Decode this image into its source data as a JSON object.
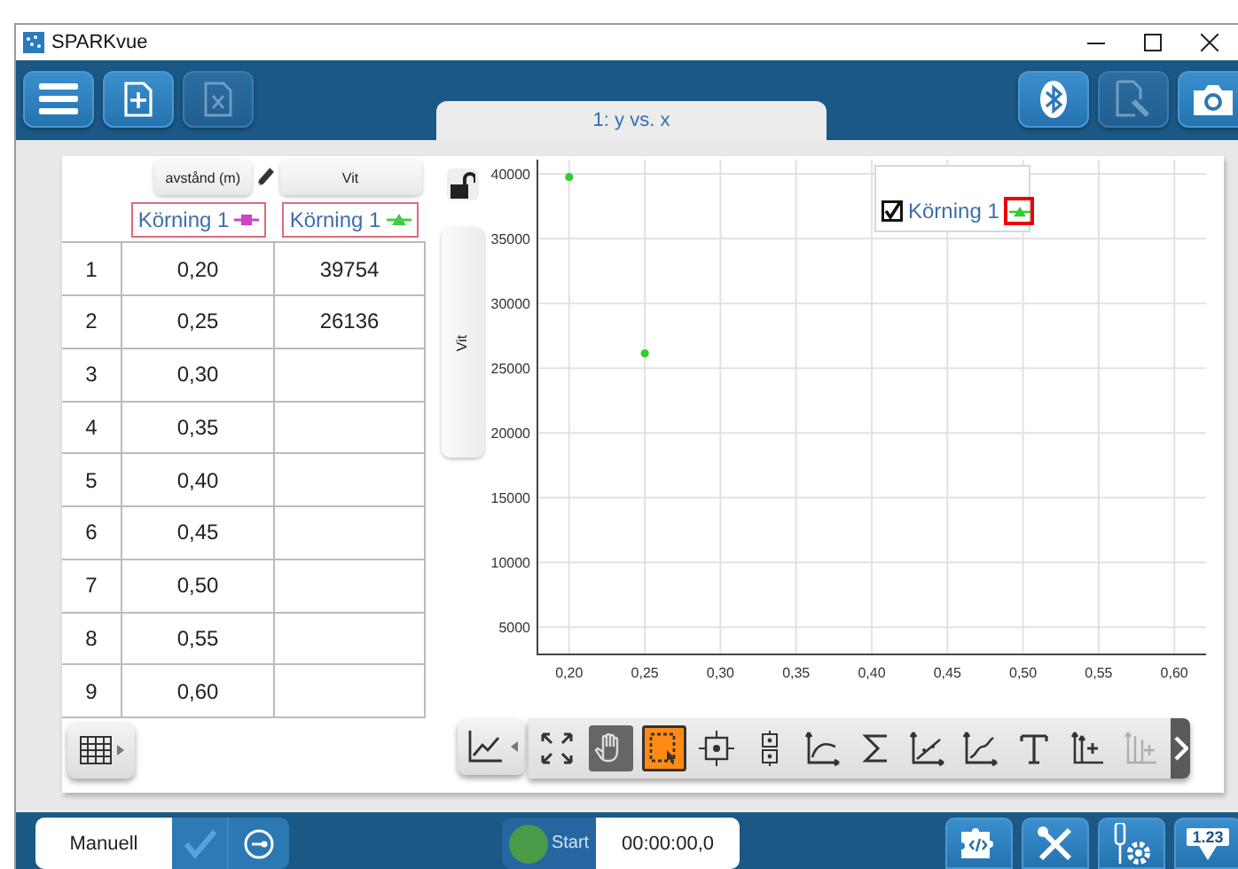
{
  "window": {
    "title": "SPARKvue"
  },
  "toolbar": {
    "left": [
      {
        "kind": "menu",
        "disabled": false
      },
      {
        "kind": "new-page",
        "disabled": false
      },
      {
        "kind": "export",
        "disabled": true
      }
    ],
    "right": [
      {
        "kind": "bluetooth",
        "disabled": false
      },
      {
        "kind": "journal",
        "disabled": true
      },
      {
        "kind": "camera",
        "disabled": false
      }
    ]
  },
  "tabs": [
    {
      "label": "1: y vs. x",
      "selected": true
    }
  ],
  "table": {
    "columns": [
      {
        "header": "avstånd (m)",
        "run": "Körning 1",
        "color": "#cc44cc"
      },
      {
        "header": "Vit",
        "run": "Körning 1",
        "color": "#44cc44"
      }
    ],
    "rows": [
      {
        "number": "1",
        "values": [
          "0,20",
          "39754"
        ]
      },
      {
        "number": "2",
        "values": [
          "0,25",
          "26136"
        ]
      },
      {
        "number": "3",
        "values": [
          "0,30"
        ]
      },
      {
        "number": "4",
        "values": [
          "0,35"
        ]
      },
      {
        "number": "5",
        "values": [
          "0,40"
        ]
      },
      {
        "number": "6",
        "values": [
          "0,45"
        ]
      },
      {
        "number": "7",
        "values": [
          "0,50"
        ]
      },
      {
        "number": "8",
        "values": [
          "0,55"
        ]
      },
      {
        "number": "9",
        "values": [
          "0,60"
        ]
      }
    ]
  },
  "graph": {
    "locked": false,
    "y_axis_label": "Vit",
    "legend": [
      {
        "checked": true
      }
    ],
    "chart_data": {
      "type": "scatter",
      "grid": true,
      "x": [
        0.2,
        0.25
      ],
      "series": [
        {
          "name": "Körning 1",
          "color": "#33cc33",
          "values": [
            39754,
            26136
          ]
        }
      ],
      "xlim": [
        0.179,
        0.621
      ],
      "ylim": [
        2900,
        41100
      ],
      "xticks": [
        {
          "value": 0.2,
          "label": "0,20"
        },
        {
          "value": 0.25,
          "label": "0,25"
        },
        {
          "value": 0.3,
          "label": "0,30"
        },
        {
          "value": 0.35,
          "label": "0,35"
        },
        {
          "value": 0.4,
          "label": "0,40"
        },
        {
          "value": 0.45,
          "label": "0,45"
        },
        {
          "value": 0.5,
          "label": "0,50"
        },
        {
          "value": 0.55,
          "label": "0,55"
        },
        {
          "value": 0.6,
          "label": "0,60"
        }
      ],
      "yticks": [
        5000,
        10000,
        15000,
        20000,
        25000,
        30000,
        35000,
        40000
      ]
    }
  },
  "graph_tools": [
    {
      "kind": "scale-fit",
      "selected": false,
      "disabled": false
    },
    {
      "kind": "pan",
      "selected": false,
      "disabled": false
    },
    {
      "kind": "select",
      "selected": true,
      "disabled": false
    },
    {
      "kind": "coordinates",
      "selected": false,
      "disabled": false
    },
    {
      "kind": "delta",
      "selected": false,
      "disabled": false
    },
    {
      "kind": "curve-fit",
      "selected": false,
      "disabled": false
    },
    {
      "kind": "statistics",
      "selected": false,
      "disabled": false
    },
    {
      "kind": "slope",
      "selected": false,
      "disabled": false
    },
    {
      "kind": "smooth-fit",
      "selected": false,
      "disabled": false
    },
    {
      "kind": "annotation",
      "selected": false,
      "disabled": false
    },
    {
      "kind": "add-axis",
      "selected": false,
      "disabled": false
    },
    {
      "kind": "multi-axis",
      "selected": false,
      "disabled": true
    }
  ],
  "bottom_bar": {
    "mode": "Manuell",
    "start_label": "Start",
    "time": "00:00:00,0",
    "display_label": "1.23"
  }
}
